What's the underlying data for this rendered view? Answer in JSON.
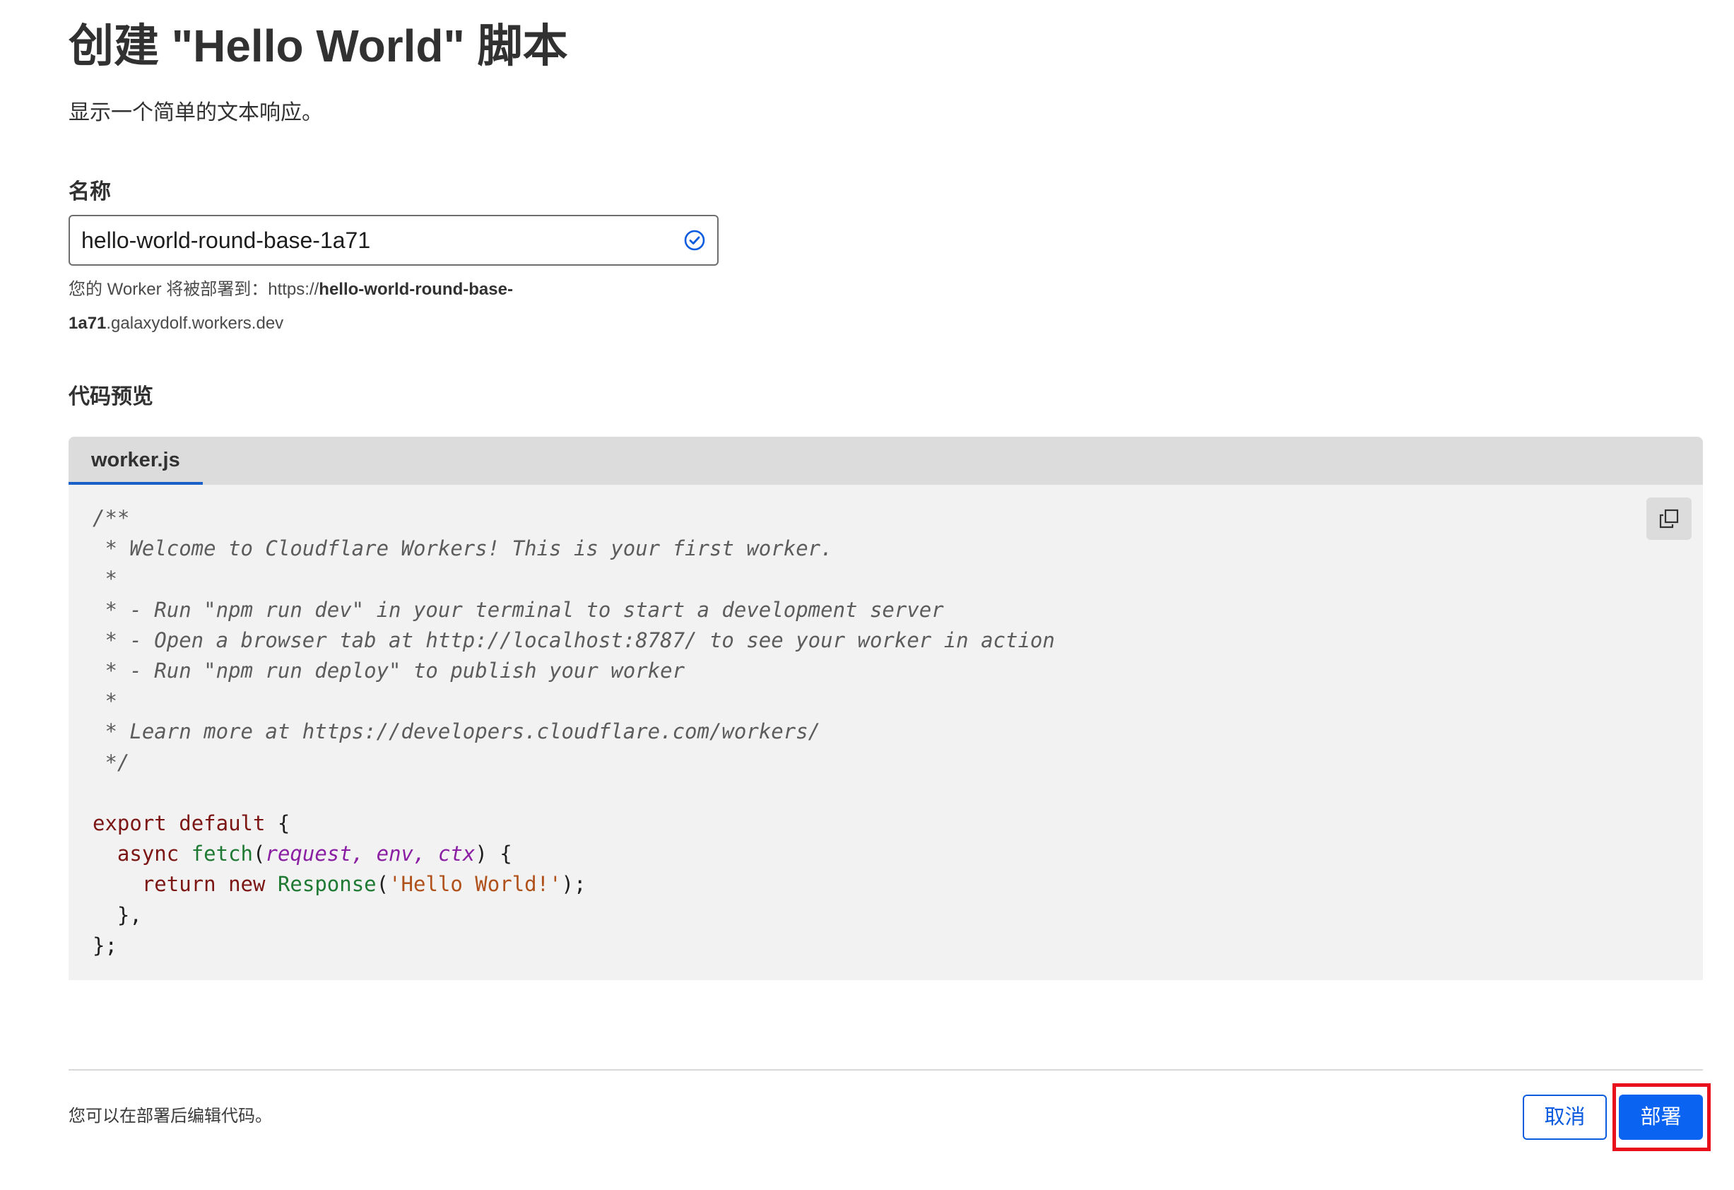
{
  "page": {
    "title": "创建 \"Hello World\" 脚本",
    "description": "显示一个简单的文本响应。"
  },
  "name_field": {
    "label": "名称",
    "value": "hello-world-round-base-1a71",
    "status": "valid"
  },
  "deploy_url": {
    "prefix": "您的 Worker 将被部署到：https://",
    "bold_part_1": "hello-world-round-base-",
    "bold_part_2": "1a71",
    "suffix": ".galaxydolf.workers.dev"
  },
  "code_preview": {
    "label": "代码预览",
    "tab_label": "worker.js",
    "copy_icon": "copy-icon",
    "comment_lines": [
      "/**",
      " * Welcome to Cloudflare Workers! This is your first worker.",
      " *",
      " * - Run \"npm run dev\" in your terminal to start a development server",
      " * - Open a browser tab at http://localhost:8787/ to see your worker in action",
      " * - Run \"npm run deploy\" to publish your worker",
      " *",
      " * Learn more at https://developers.cloudflare.com/workers/",
      " */"
    ],
    "tokens": {
      "export": "export",
      "default": "default",
      "brace_open": " {",
      "async": "async",
      "fetch": "fetch",
      "paren_open": "(",
      "param_request": "request",
      "param_env": "env",
      "param_ctx": "ctx",
      "comma_space": ", ",
      "paren_close_brace": ") {",
      "return": "return",
      "new": "new",
      "response": "Response",
      "string": "'Hello World!'",
      "call_end": ");",
      "inner_close": "},",
      "outer_close": "};"
    }
  },
  "footer": {
    "note": "您可以在部署后编辑代码。",
    "cancel_label": "取消",
    "deploy_label": "部署"
  },
  "colors": {
    "accent": "#0b63f2",
    "highlight_frame": "#e8101b",
    "tab_underline": "#1960c7"
  }
}
